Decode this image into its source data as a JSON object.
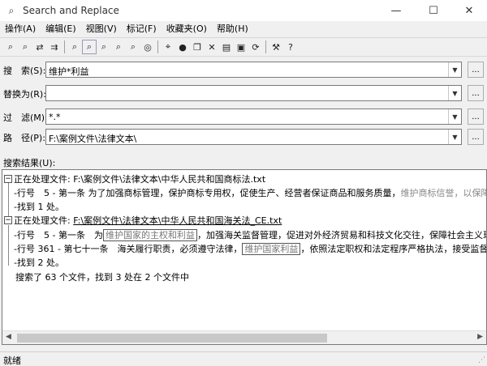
{
  "window": {
    "title": "Search and Replace"
  },
  "menu": [
    "操作(A)",
    "编辑(E)",
    "视图(V)",
    "标记(F)",
    "收藏夹(O)",
    "帮助(H)"
  ],
  "toolbar": {
    "groups": [
      [
        "binoculars-icon",
        "binoculars-list-icon",
        "replace-icon",
        "replace-next-icon"
      ],
      [
        "search-files-icon",
        "search-files-active-icon",
        "search-tag-icon",
        "search-fav-icon",
        "search-all-icon",
        "search-options-icon"
      ],
      [
        "tag-icon",
        "globe-icon",
        "copy-icon",
        "delete-icon",
        "print-icon",
        "save-icon",
        "refresh-icon"
      ],
      [
        "tools-icon",
        "help-icon"
      ]
    ]
  },
  "fields": {
    "search": {
      "label": "搜　索(S):",
      "value": "维护*利益"
    },
    "replace": {
      "label": "替换为(R):",
      "value": ""
    },
    "filter": {
      "label": "过　滤(M):",
      "value": "*.*"
    },
    "path": {
      "label": "路　径(P):",
      "value": "F:\\案例文件\\法律文本\\"
    },
    "browse_label": "..."
  },
  "results": {
    "label": "搜索结果(U):",
    "file1": {
      "prefix": "正在处理文件: ",
      "path": "F:\\案例文件\\法律文本\\中华人民共和国商标法.txt"
    },
    "line1": {
      "prefix": "行号　5 - 第一条 为了加强商标管理，保护商标专用权，促使生产、经营者保证商品和服务质量，",
      "faded": "维护商标信誉，以保障消费者"
    },
    "found1": "找到 1 处。",
    "file2": {
      "prefix": "正在处理文件: ",
      "path": "F:\\案例文件\\法律文本\\中华人民共和国海关法_CE.txt"
    },
    "line2": {
      "prefix": "行号　5 - 第一条　为",
      "hl": "维护国家的主权和利益",
      "suffix": "，加强海关监督管理，促进对外经济贸易和科技文化交往，保障社会主义现代化"
    },
    "line3": {
      "prefix": "行号 361 - 第七十一条　海关履行职责，必须遵守法律，",
      "hl": "维护国家利益",
      "suffix": "，依照法定职权和法定程序严格执法，接受监督。"
    },
    "found2": "找到 2 处。",
    "summary": "搜索了 63 个文件，找到 3 处在 2 个文件中"
  },
  "status": "就绪"
}
